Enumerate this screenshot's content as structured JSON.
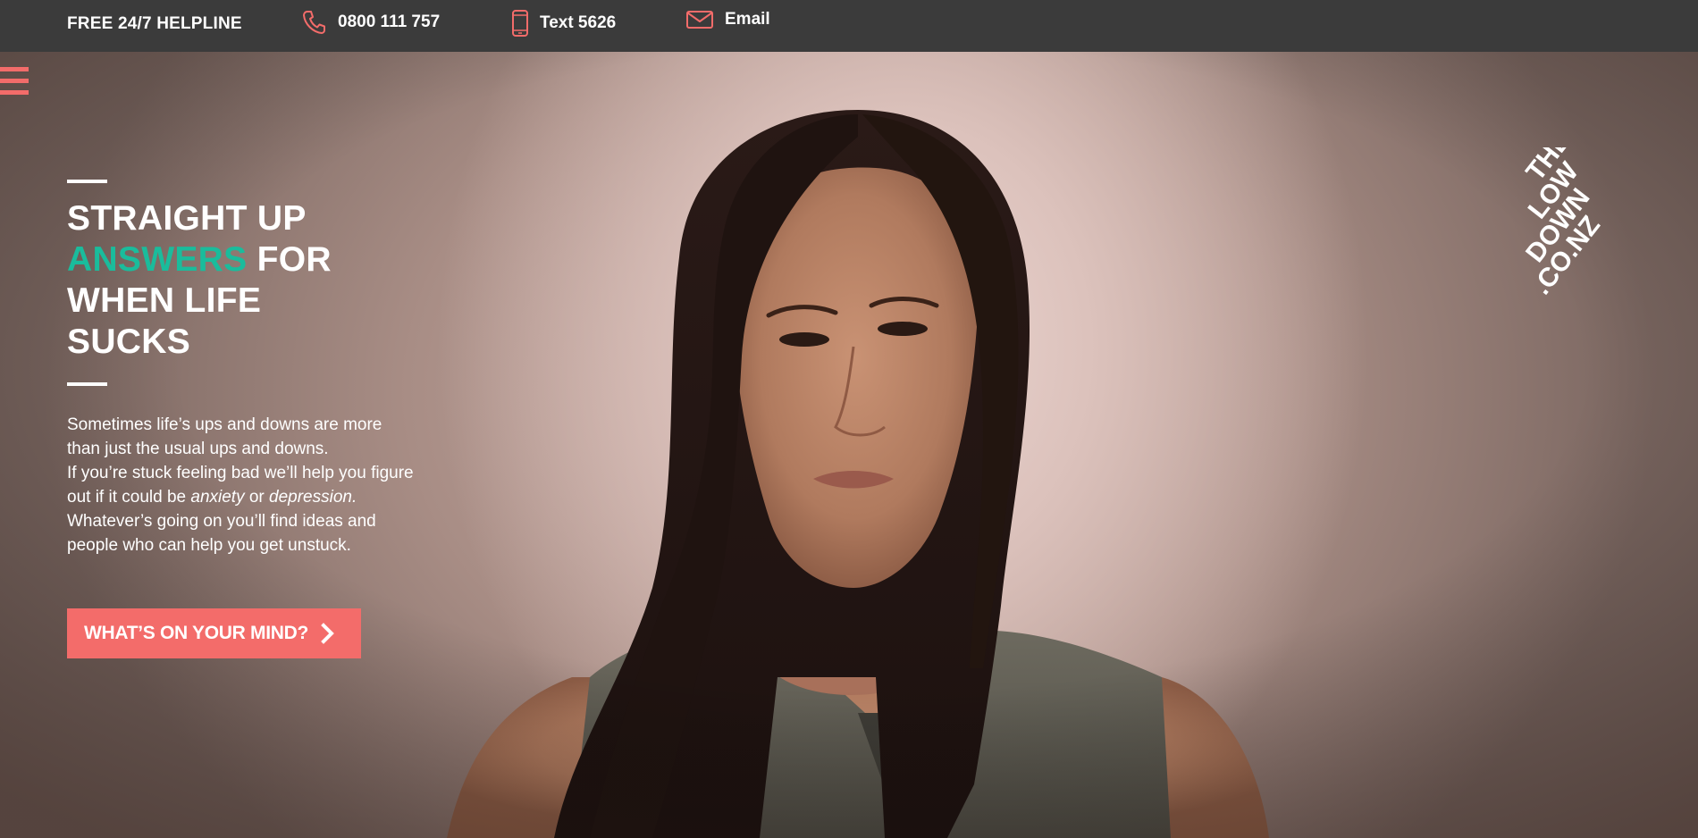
{
  "topbar": {
    "helpline_label": "FREE 24/7 HELPLINE",
    "phone": {
      "label": "0800 111 757",
      "icon": "phone-icon"
    },
    "text": {
      "label": "Text 5626",
      "icon": "mobile-icon"
    },
    "email": {
      "label": "Email",
      "icon": "envelope-icon"
    }
  },
  "hero": {
    "headline": {
      "line1": "STRAIGHT UP",
      "accent": "ANSWERS",
      "line2_rest": " FOR",
      "line3": "WHEN LIFE",
      "line4": "SUCKS"
    },
    "intro": {
      "p1": "Sometimes life’s ups and downs are more than just the usual ups and downs.",
      "p2_start": "If you’re stuck feeling bad we’ll help you figure out if it could be ",
      "anxiety": "anxiety",
      "or": " or ",
      "depression": "depression.",
      "p3": "Whatever’s going on you’ll find ideas and people who can help you get unstuck."
    },
    "cta_label": "WHAT’S ON YOUR MIND?",
    "logo_text": [
      "THE",
      "LOW",
      "DOWN",
      ".CO.NZ"
    ]
  },
  "colors": {
    "accent_coral": "#f36c6a",
    "accent_teal": "#1abc9c",
    "topbar_bg": "#3b3b3b"
  }
}
